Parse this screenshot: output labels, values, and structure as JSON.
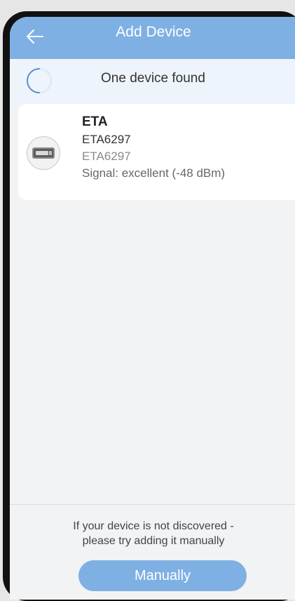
{
  "header": {
    "title": "Add Device",
    "back_icon": "arrow-left-icon"
  },
  "scan": {
    "status": "One device found",
    "spinner_icon": "loading-spinner-icon"
  },
  "devices": [
    {
      "name": "ETA",
      "model": "ETA6297",
      "subtitle": "ETA6297",
      "signal": "Signal: excellent (-48 dBm)",
      "icon": "device-thumbnail-icon"
    }
  ],
  "footer": {
    "hint_line1": "If your device is not discovered -",
    "hint_line2": "please try adding it manually",
    "button_label": "Manually"
  },
  "colors": {
    "accent": "#7fb0e3",
    "background": "#f2f3f5",
    "scan_bar": "#eef4fb"
  }
}
